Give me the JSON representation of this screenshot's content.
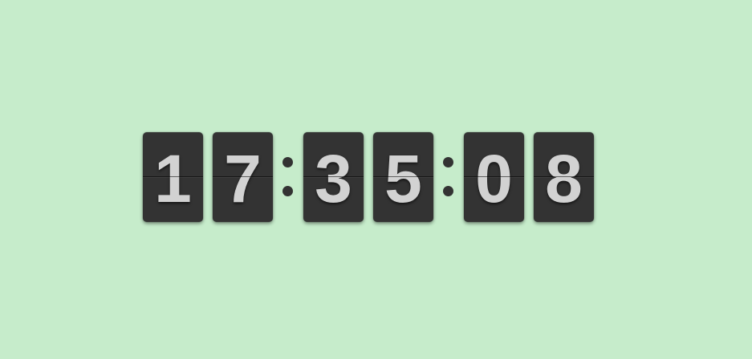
{
  "clock": {
    "hours": [
      "1",
      "7"
    ],
    "minutes": [
      "3",
      "5"
    ],
    "seconds": [
      "0",
      "8"
    ]
  },
  "colors": {
    "background": "#c6eccb",
    "card": "#333333",
    "digit": "#d2d2d2"
  }
}
